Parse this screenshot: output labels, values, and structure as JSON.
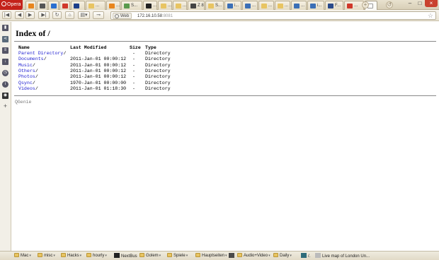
{
  "browser": {
    "menu_label": "Opera",
    "tabs": [
      {
        "label": "",
        "color": "#e8851c"
      },
      {
        "label": "",
        "color": "#555555"
      },
      {
        "label": "",
        "color": "#2a6fd0"
      },
      {
        "label": "",
        "color": "#d0382a"
      },
      {
        "label": "",
        "color": "#1d3f8a"
      },
      {
        "label": "...",
        "color": "#e8c462"
      },
      {
        "label": "...",
        "color": "#e8851c"
      },
      {
        "label": "S...",
        "color": "#5a9a4c"
      },
      {
        "label": "...",
        "color": "#222222"
      },
      {
        "label": "...",
        "color": "#e8c462"
      },
      {
        "label": "...",
        "color": "#e8c462"
      },
      {
        "label": "Z 8...",
        "color": "#444444"
      },
      {
        "label": "S...",
        "color": "#e8c462"
      },
      {
        "label": "i...",
        "color": "#3b6fb6"
      },
      {
        "label": "...",
        "color": "#3b6fb6"
      },
      {
        "label": "...",
        "color": "#e8c462"
      },
      {
        "label": "...",
        "color": "#e8c462"
      },
      {
        "label": "...",
        "color": "#3b6fb6"
      },
      {
        "label": "i...",
        "color": "#3b6fb6"
      },
      {
        "label": "F...",
        "color": "#2a4a8a"
      },
      {
        "label": "...",
        "color": "#d0382a"
      },
      {
        "label": "",
        "color": "#ffffff"
      }
    ],
    "window_controls": {
      "minimize": "–",
      "maximize": "□",
      "close": "×"
    }
  },
  "toolbar": {
    "mode_label": "Web",
    "url_host": "172.16.10.58",
    "url_port": ":8081"
  },
  "page": {
    "title": "Index of /",
    "columns": {
      "name": "Name",
      "modified": "Last Modified",
      "size": "Size",
      "type": "Type"
    },
    "rows": [
      {
        "name": "Parent Directory",
        "suffix": "/",
        "modified": "",
        "size": "-",
        "type": "Directory"
      },
      {
        "name": "Documents",
        "suffix": "/",
        "modified": "2011-Jan-01 00:00:12",
        "size": "-",
        "type": "Directory"
      },
      {
        "name": "Music",
        "suffix": "/",
        "modified": "2011-Jan-01 00:00:12",
        "size": "-",
        "type": "Directory"
      },
      {
        "name": "Others",
        "suffix": "/",
        "modified": "2011-Jan-01 00:00:12",
        "size": "-",
        "type": "Directory"
      },
      {
        "name": "Photos",
        "suffix": "/",
        "modified": "2011-Jan-01 00:00:12",
        "size": "-",
        "type": "Directory"
      },
      {
        "name": "Qsync",
        "suffix": "/",
        "modified": "1970-Jan-01 00:00:00",
        "size": "-",
        "type": "Directory"
      },
      {
        "name": "Videos",
        "suffix": "/",
        "modified": "2011-Jan-01 01:18:30",
        "size": "-",
        "type": "Directory"
      }
    ],
    "footer": "QGenie",
    "link_color": "#1c1cd0"
  },
  "bookmarks": [
    {
      "label": "Mac",
      "icon": "folder-icon"
    },
    {
      "label": "misc",
      "icon": "folder-icon"
    },
    {
      "label": "Hacks",
      "icon": "folder-icon"
    },
    {
      "label": "hourly",
      "icon": "folder-icon"
    },
    {
      "label": "NextBus",
      "icon": "nextbus-icon"
    },
    {
      "label": "Golem",
      "icon": "folder-icon"
    },
    {
      "label": "Spiele",
      "icon": "folder-icon"
    },
    {
      "label": "Hauptseiten",
      "icon": "folder-icon"
    },
    {
      "label": "",
      "icon": "box-icon"
    },
    {
      "label": "Audio+Video",
      "icon": "folder-icon"
    },
    {
      "label": "Daily",
      "icon": "folder-icon"
    },
    {
      "label": "/.",
      "icon": "slashdot-icon"
    },
    {
      "label": "Live map of London Un...",
      "icon": "link-icon"
    }
  ]
}
